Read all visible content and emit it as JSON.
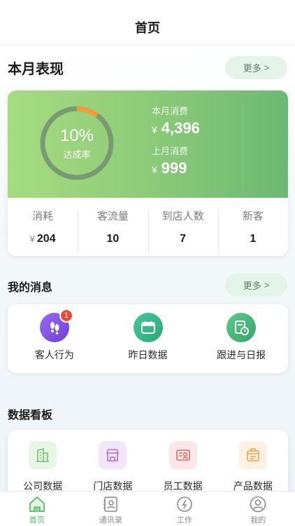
{
  "header": {
    "title": "首页"
  },
  "performance": {
    "title": "本月表现",
    "more_label": "更多",
    "more_arrow": ">",
    "ring": {
      "percent_text": "10%",
      "label": "达成率",
      "fraction": 0.1
    },
    "this_month": {
      "label": "本月消费",
      "currency": "¥",
      "value": "4,396"
    },
    "last_month": {
      "label": "上月消费",
      "currency": "¥",
      "value": "999"
    },
    "stats": [
      {
        "label": "消耗",
        "currency": "¥",
        "value": "204"
      },
      {
        "label": "客流量",
        "value": "10"
      },
      {
        "label": "到店人数",
        "value": "7"
      },
      {
        "label": "新客",
        "value": "1"
      }
    ],
    "colors": {
      "gradient_start": "#a6dc80",
      "gradient_end": "#6cb974",
      "ring_track": "#7a9a74",
      "ring_progress": "#f49a3c"
    }
  },
  "messages": {
    "title": "我的消息",
    "more_label": "更多",
    "more_arrow": ">",
    "items": [
      {
        "label": "客人行为",
        "icon": "footprints-icon",
        "badge": "1"
      },
      {
        "label": "昨日数据",
        "icon": "calendar-icon"
      },
      {
        "label": "跟进与日报",
        "icon": "report-clock-icon"
      }
    ]
  },
  "board": {
    "title": "数据看板",
    "items": [
      {
        "label": "公司数据",
        "icon": "building-icon"
      },
      {
        "label": "门店数据",
        "icon": "store-icon"
      },
      {
        "label": "员工数据",
        "icon": "employee-card-icon"
      },
      {
        "label": "产品数据",
        "icon": "product-box-icon"
      }
    ]
  },
  "tabbar": {
    "items": [
      {
        "label": "首页",
        "icon": "home-icon",
        "active": true
      },
      {
        "label": "通讯录",
        "icon": "contacts-icon"
      },
      {
        "label": "工作",
        "icon": "work-icon"
      },
      {
        "label": "我的",
        "icon": "profile-icon"
      }
    ]
  }
}
